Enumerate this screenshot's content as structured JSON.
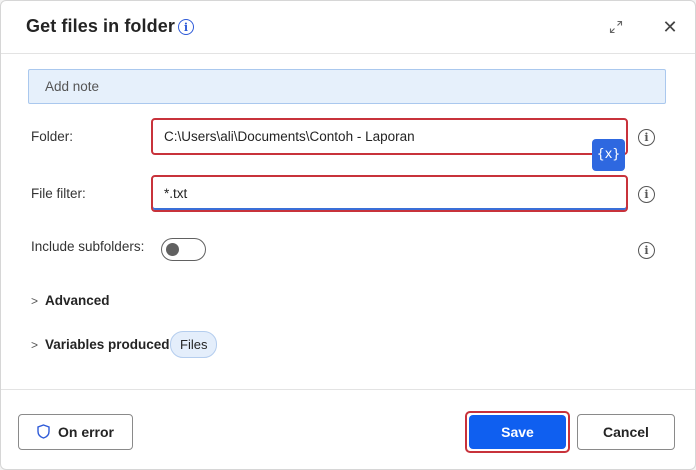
{
  "dialog": {
    "title": "Get files in folder",
    "icons": {
      "info": "info-icon",
      "expand": "expand-icon",
      "close": "close-icon"
    },
    "close_glyph": "✕"
  },
  "note": {
    "placeholder": "Add note"
  },
  "fields": {
    "folder": {
      "label": "Folder:",
      "value": "C:\\Users\\ali\\Documents\\Contoh - Laporan"
    },
    "file_filter": {
      "label": "File filter:",
      "value": "*.txt"
    },
    "include_subfolders": {
      "label": "Include subfolders:",
      "enabled": false
    }
  },
  "variable_button": {
    "glyph": "{x}"
  },
  "sections": {
    "advanced": {
      "label": "Advanced",
      "chevron": ">"
    },
    "variables_produced": {
      "label": "Variables produced",
      "chevron": ">",
      "chip": "Files"
    }
  },
  "footer": {
    "on_error_label": "On error",
    "save_label": "Save",
    "cancel_label": "Cancel"
  },
  "colors": {
    "primary": "#0f5ff0",
    "highlight": "#c8323b",
    "note_bg": "#e6f0fb",
    "chip_bg": "#e4eefb"
  }
}
